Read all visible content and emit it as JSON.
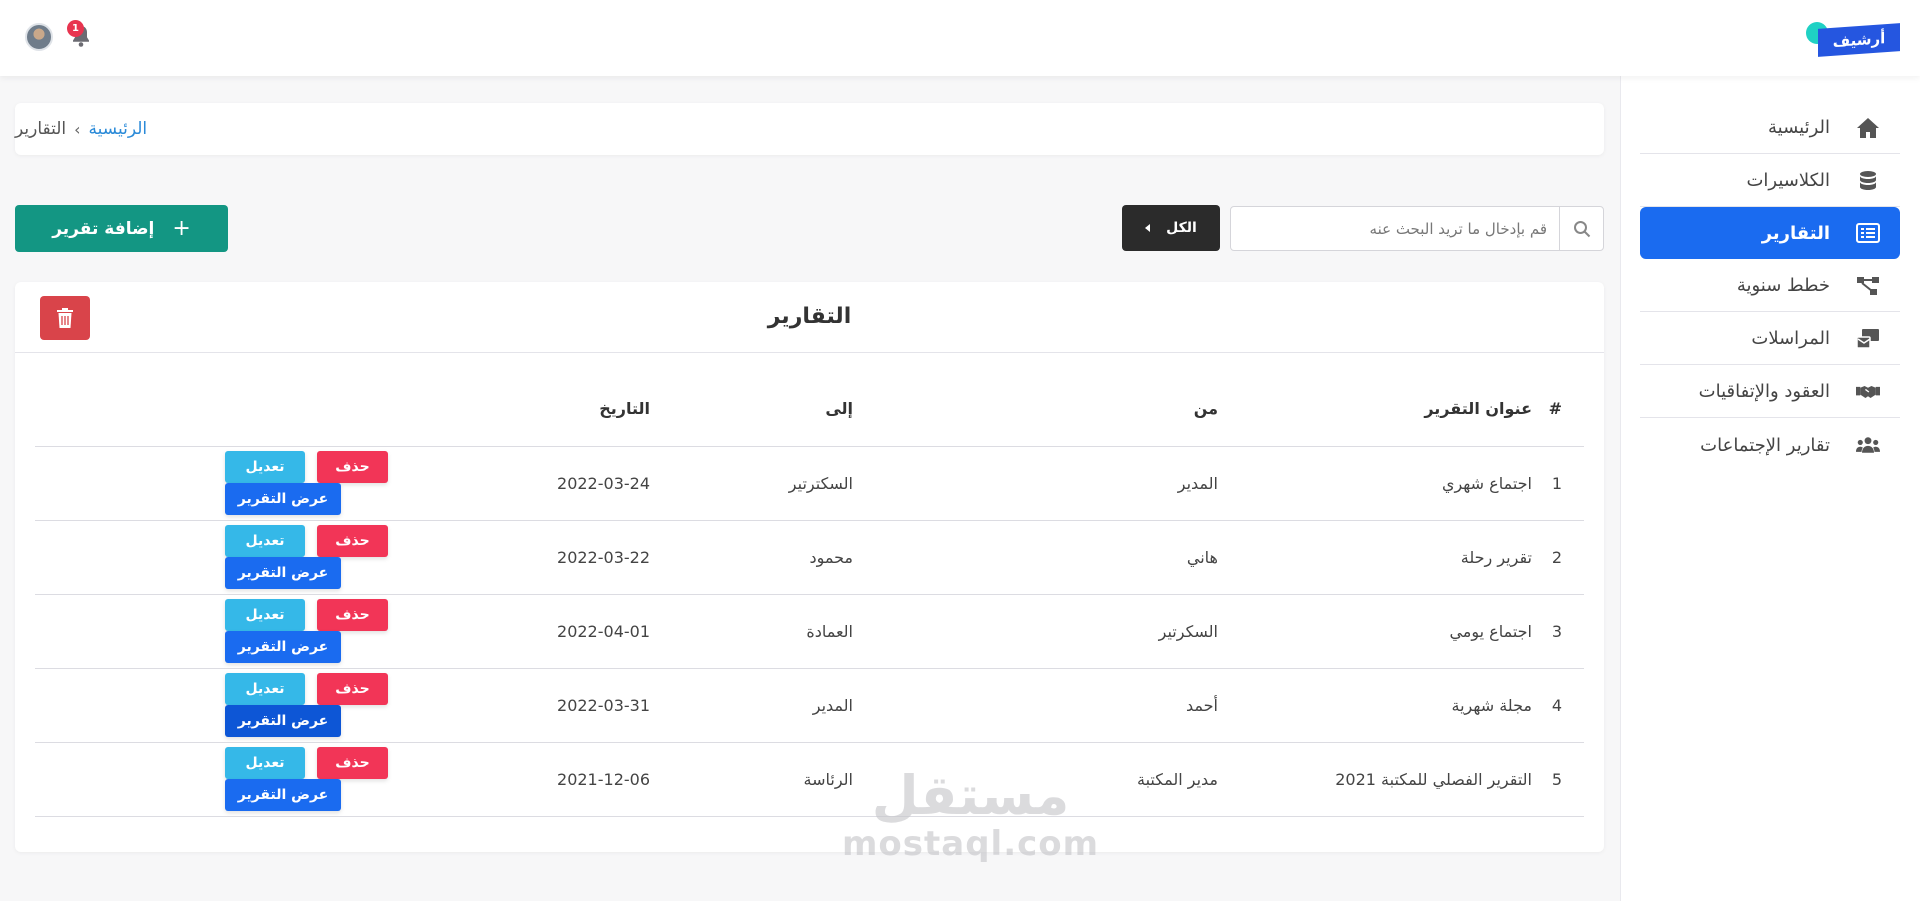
{
  "header": {
    "logo_text": "أرشيف",
    "notification_count": "1"
  },
  "sidebar": {
    "items": [
      {
        "label": "الرئيسية",
        "icon": "home-icon"
      },
      {
        "label": "الكلاسيرات",
        "icon": "database-icon"
      },
      {
        "label": "التقارير",
        "icon": "list-icon",
        "active": true
      },
      {
        "label": "خطط سنوية",
        "icon": "sitemap-icon"
      },
      {
        "label": "المراسلات",
        "icon": "mail-bulk-icon"
      },
      {
        "label": "العقود والإتفاقيات",
        "icon": "handshake-icon"
      },
      {
        "label": "تقارير الإجتماعات",
        "icon": "users-icon"
      }
    ]
  },
  "breadcrumb": {
    "home": "الرئيسية",
    "separator": "›",
    "current": "التقارير"
  },
  "toolbar": {
    "search_placeholder": "قم بإدخال ما تريد البحث عنه",
    "filter_label": "الكل",
    "add_label": "إضافة تقرير",
    "add_icon": "+"
  },
  "card": {
    "title": "التقارير"
  },
  "table": {
    "headers": {
      "num": "#",
      "title": "عنوان التقرير",
      "from": "من",
      "to": "إلى",
      "date": "التاريخ"
    },
    "actions": {
      "view": "عرض التقرير",
      "edit": "تعديل",
      "delete": "حذف"
    },
    "rows": [
      {
        "num": "1",
        "title": "اجتماع شهري",
        "from": "المدير",
        "to": "السكترتير",
        "date": "2022-03-24"
      },
      {
        "num": "2",
        "title": "تقرير رحلة",
        "from": "هاني",
        "to": "محمود",
        "date": "2022-03-22"
      },
      {
        "num": "3",
        "title": "اجتماع يومي",
        "from": "السكرتير",
        "to": "العمادة",
        "date": "2022-04-01"
      },
      {
        "num": "4",
        "title": "مجلة شهرية",
        "from": "أحمد",
        "to": "المدير",
        "date": "2022-03-31"
      },
      {
        "num": "5",
        "title": "التقرير الفصلي للمكتبة 2021",
        "from": "مدير المكتبة",
        "to": "الرئاسة",
        "date": "2021-12-06"
      }
    ]
  },
  "watermark": {
    "arabic": "مستقل",
    "latin": "mostaql.com"
  },
  "colors": {
    "primary": "#1a6bf0",
    "success": "#139683",
    "danger": "#f23557",
    "info": "#35b8e8",
    "dark": "#2b2b2b",
    "trash": "#d9444a"
  }
}
